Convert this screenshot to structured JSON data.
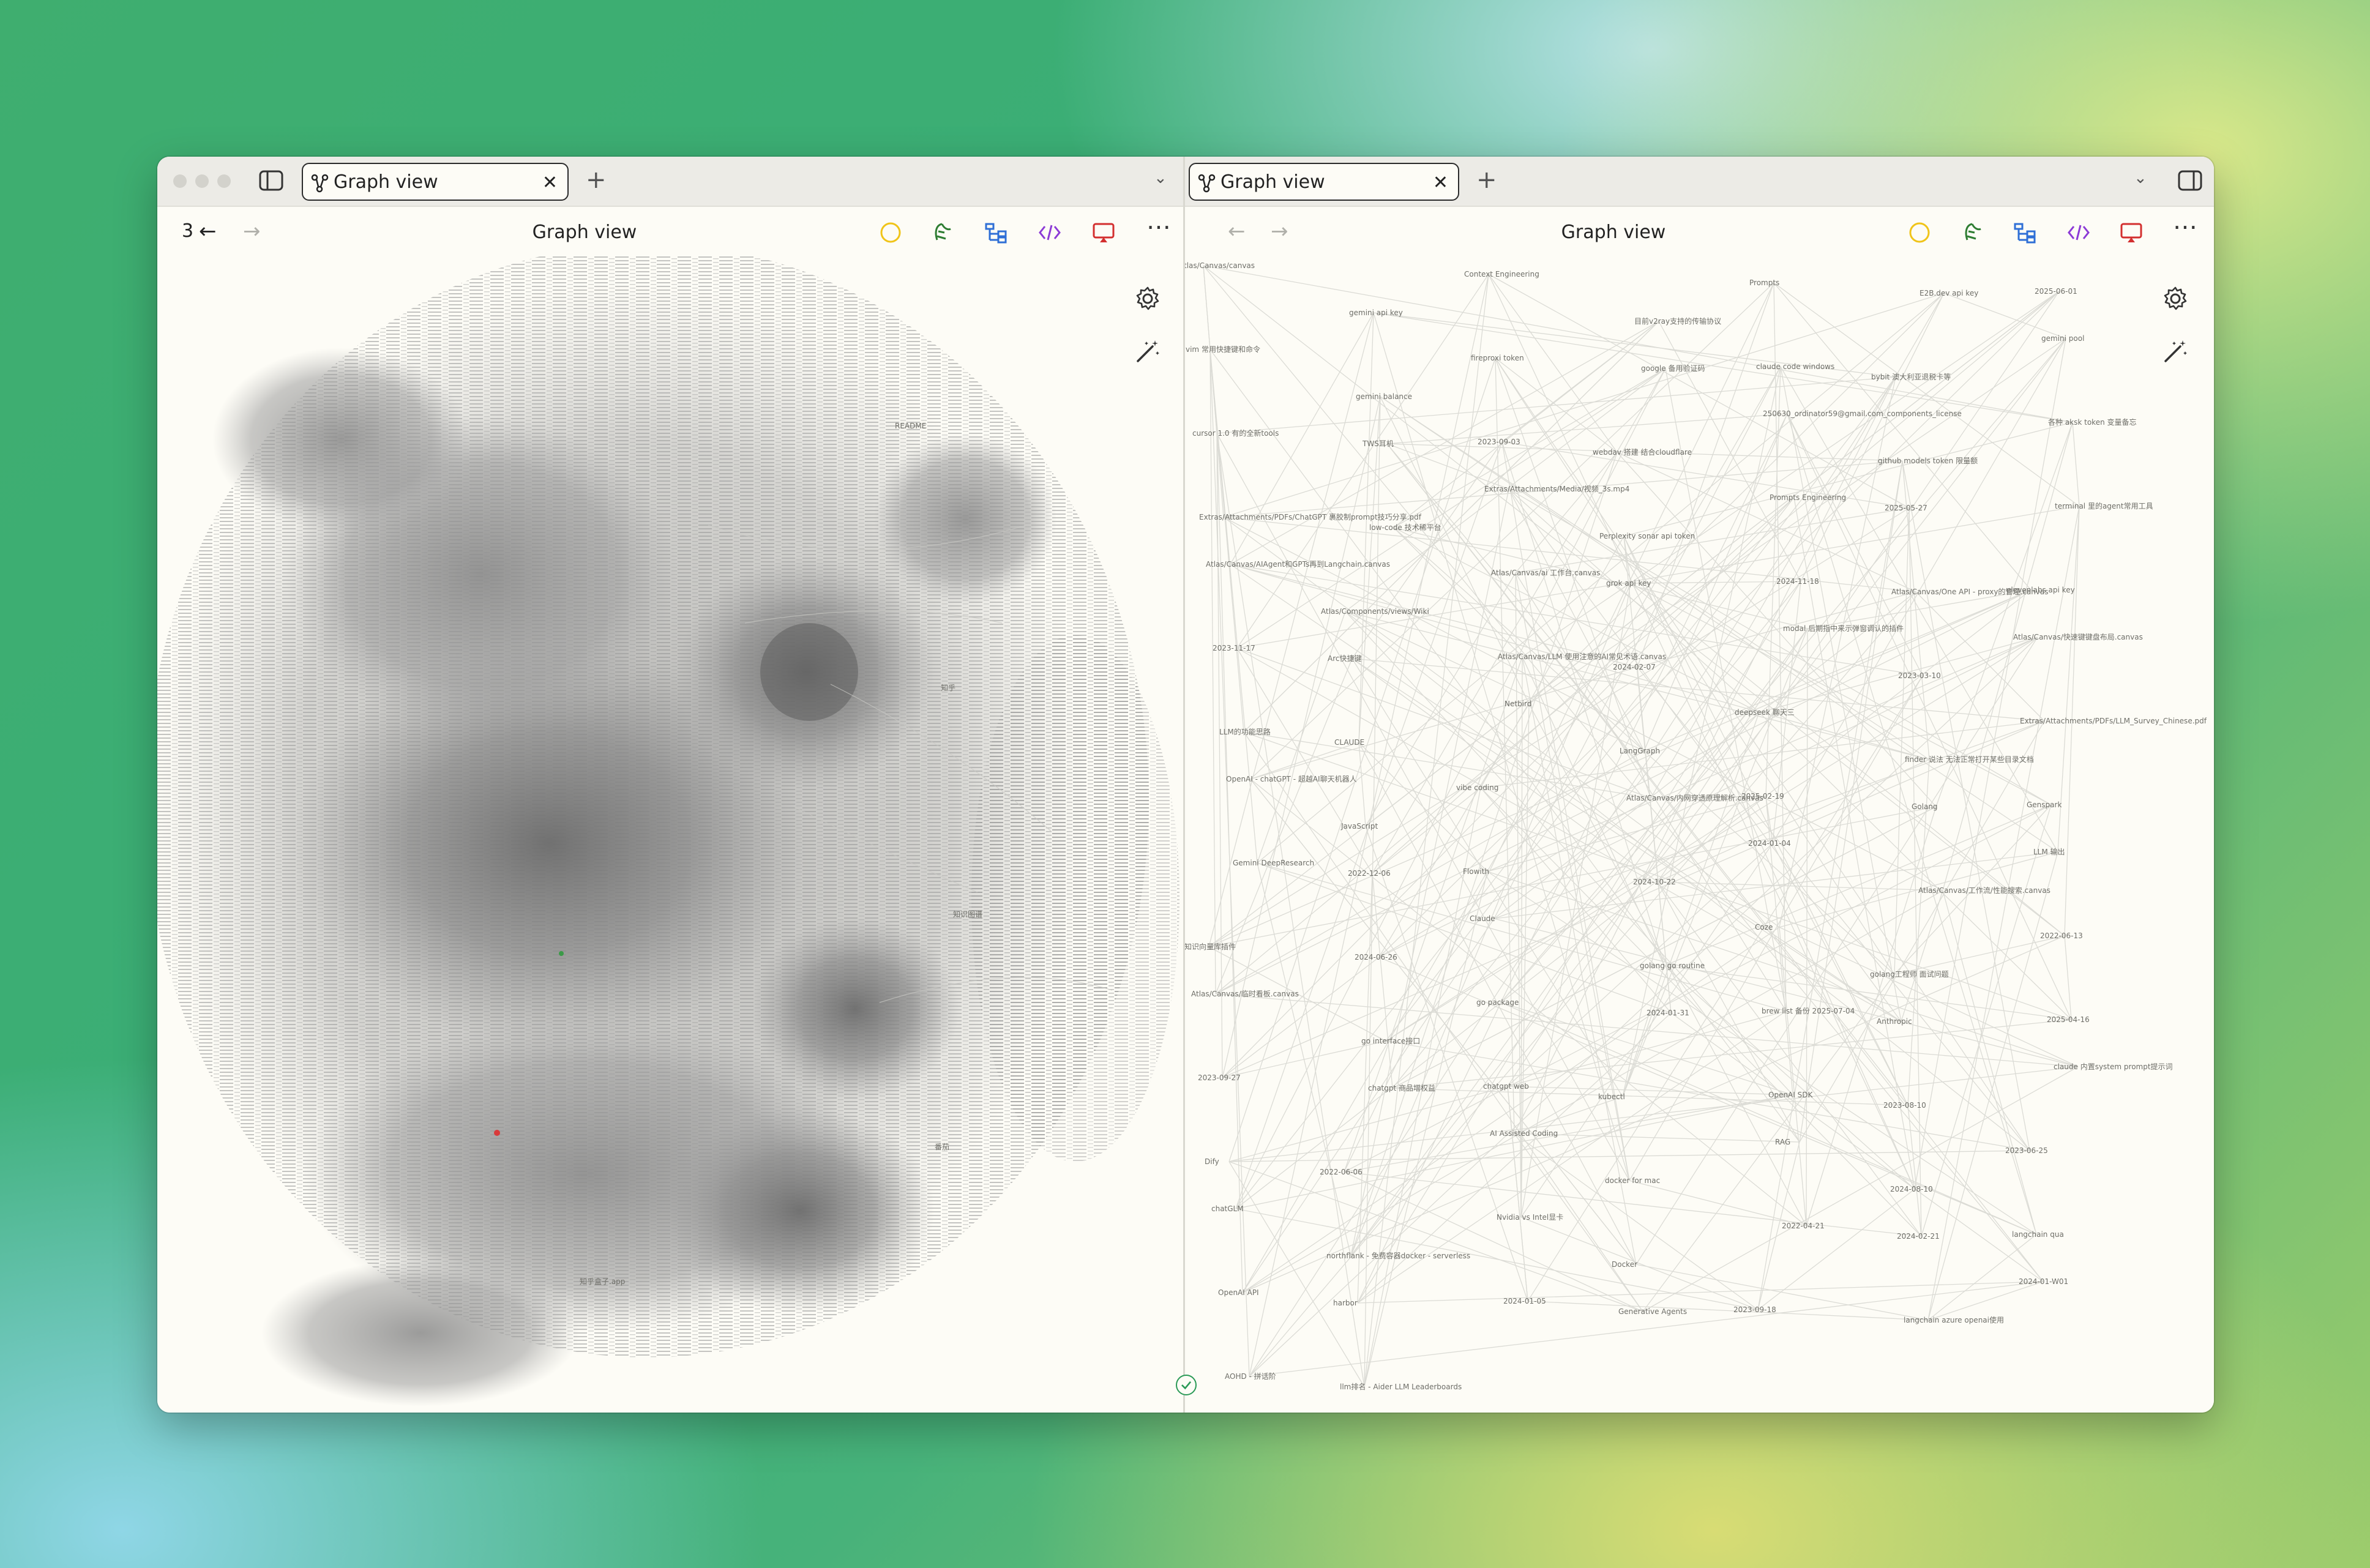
{
  "left_pane": {
    "tab": {
      "title": "Graph view",
      "close": "✕"
    },
    "new_tab": "+",
    "overflow": "⌄",
    "header": {
      "title": "Graph view",
      "back_count": "3",
      "back": "←",
      "forward": "→",
      "more": "⋯"
    },
    "graph_labels": [
      "README",
      "知乎",
      "知乎盒子.app",
      "番茄",
      "知识图谱"
    ]
  },
  "right_pane": {
    "tab": {
      "title": "Graph view",
      "close": "✕"
    },
    "new_tab": "+",
    "overflow": "⌄",
    "header": {
      "title": "Graph view",
      "back": "←",
      "forward": "→",
      "more": "⋯"
    },
    "graph_labels": [
      "Atlas/Canvas/canvas",
      "gemini api key",
      "Context Engineering",
      "目前v2ray支持的传输协议",
      "Prompts",
      "E2B.dev api key",
      "2025-06-01",
      "vim 常用快捷键和命令",
      "gemini balance",
      "fireproxi token",
      "google 备用验证码",
      "claude code windows",
      "bybit 澳大利亚退税卡等",
      "gemini pool",
      "cursor 1.0 有的全新tools",
      "TWS耳机",
      "2023-09-03",
      "webdav 搭建 结合cloudflare",
      "250630_ordinator59@gmail.com_components_license",
      "github models token 限量额",
      "各种 aksk token 变量备忘",
      "Extras/Attachments/PDFs/ChatGPT 裹胶制prompt技巧分享.pdf",
      "low-code 技术稀平台",
      "Extras/Attachments/Media/视频_3s.mp4",
      "Perplexity sonar api token",
      "Prompts Engineering",
      "2025-05-27",
      "terminal 里的agent常用工具",
      "Atlas/Canvas/AIAgent和GPTs再到Langchain.canvas",
      "Atlas/Components/views/Wiki",
      "Atlas/Canvas/ai 工作台.canvas",
      "grok api key",
      "2024-11-18",
      "Atlas/Canvas/One API - proxy的管理.canvas",
      "elevenlabs api key",
      "2023-11-17",
      "Arc快捷键",
      "Atlas/Canvas/LLM 使用注意的AI常见术语.canvas",
      "2024-02-07",
      "modal 后期指中来示弹窗调认的插件",
      "2023-03-10",
      "Atlas/Canvas/快速键键盘布局.canvas",
      "LLM的功能思路",
      "CLAUDE",
      "Netbird",
      "LangGraph",
      "deepseek 聊天三",
      "finder 说法 无法正常打开某些目录文档",
      "Extras/Attachments/PDFs/LLM_Survey_Chinese.pdf",
      "OpenAI - chatGPT - 超越AI聊天机器人",
      "JavaScript",
      "vibe coding",
      "Atlas/Canvas/内网穿透原理解析.canvas",
      "2025-02-19",
      "Golang",
      "Genspark",
      "Gemini DeepResearch",
      "2022-12-06",
      "Flowith",
      "2024-10-22",
      "2024-01-04",
      "Atlas/Canvas/工作流/性能搜索.canvas",
      "LLM 输出",
      "知识向量库插件",
      "2024-06-26",
      "Claude",
      "golang go routine",
      "Coze",
      "golang工程师 面试问题",
      "2022-06-13",
      "Atlas/Canvas/临时看板.canvas",
      "go interface接口",
      "go package",
      "2024-01-31",
      "brew list 备份 2025-07-04",
      "Anthropic",
      "2025-04-16",
      "2023-09-27",
      "chatgpt 商品增权益",
      "chatgpt web",
      "kubectl",
      "OpenAI SDK",
      "2023-08-10",
      "claude 内置system prompt提示词",
      "Dify",
      "2022-06-06",
      "AI Assisted Coding",
      "docker for mac",
      "RAG",
      "2024-08-10",
      "2023-06-25",
      "chatGLM",
      "northflank - 免费容器docker - serverless",
      "Nvidia vs Intel显卡",
      "Docker",
      "2022-04-21",
      "2024-02-21",
      "langchain qua",
      "OpenAI API",
      "harbor",
      "2024-01-05",
      "Generative Agents",
      "2023-09-18",
      "langchain azure openai使用",
      "2024-01-W01",
      "AOHD - 拼话阶",
      "llm排名 - Aider LLM Leaderboards"
    ]
  },
  "colors": {
    "accent_yellow": "#f0c419",
    "accent_green": "#2e7d32",
    "accent_blue": "#2f6fd6",
    "accent_purple": "#8c3bd6",
    "accent_red": "#d32f2f",
    "status_ok": "#2b9a57"
  },
  "icons": {
    "sidebar": "sidebar-toggle-icon",
    "tab": "graph-icon",
    "ribbon_1": "sun-icon",
    "ribbon_2": "leaf-icon",
    "ribbon_3": "tree-icon",
    "ribbon_4": "code-icon",
    "ribbon_5": "cast-icon",
    "graph_settings": "gear-icon",
    "graph_animate": "magic-wand-icon",
    "status": "sync-check-icon"
  }
}
